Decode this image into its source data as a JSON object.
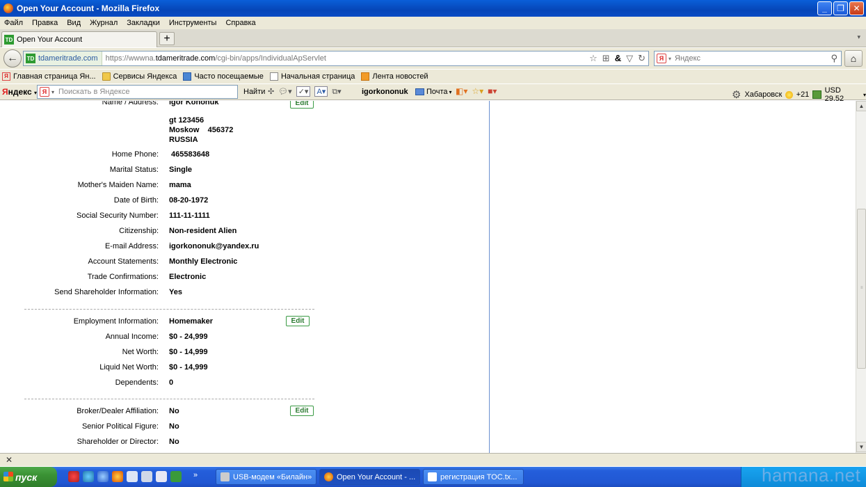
{
  "window": {
    "title": "Open Your Account - Mozilla Firefox"
  },
  "menu": [
    "Файл",
    "Правка",
    "Вид",
    "Журнал",
    "Закладки",
    "Инструменты",
    "Справка"
  ],
  "tab": {
    "label": "Open Your Account"
  },
  "nav": {
    "site": "tdameritrade.com",
    "url_prefix": "https://wwwna.",
    "url_domain": "tdameritrade.com",
    "url_path": "/cgi-bin/apps/IndividualApServlet",
    "search_placeholder": "Яндекс"
  },
  "bookmarks": [
    {
      "label": "Главная страница Ян...",
      "icon": "yandex-icon"
    },
    {
      "label": "Сервисы Яндекса",
      "icon": "folder-icon"
    },
    {
      "label": "Часто посещаемые",
      "icon": "bookmark-icon"
    },
    {
      "label": "Начальная страница",
      "icon": "page-icon"
    },
    {
      "label": "Лента новостей",
      "icon": "rss-icon"
    }
  ],
  "yandex_bar": {
    "logo_first": "Я",
    "logo_rest": "ндекс",
    "search_placeholder": "Поискать в Яндексе",
    "find_label": "Найти",
    "user": "igorkononuk",
    "mail": "Почта",
    "city": "Хабаровск",
    "temp": "+21",
    "currency": "USD 29,52"
  },
  "form": {
    "edit_label": "Edit",
    "personal": [
      {
        "label": "Name / Address:",
        "value": "igor  Kononuk"
      },
      {
        "label": "",
        "value": "gt 123456"
      },
      {
        "label": "",
        "value": "Moskow    456372"
      },
      {
        "label": "",
        "value": "RUSSIA"
      },
      {
        "label": "Home Phone:",
        "value": "465583648"
      },
      {
        "label": "Marital Status:",
        "value": "Single"
      },
      {
        "label": "Mother's Maiden Name:",
        "value": "mama"
      },
      {
        "label": "Date of Birth:",
        "value": "08-20-1972"
      },
      {
        "label": "Social Security Number:",
        "value": "111-11-1111"
      },
      {
        "label": "Citizenship:",
        "value": "Non-resident Alien"
      },
      {
        "label": "E-mail Address:",
        "value": "igorkononuk@yandex.ru"
      },
      {
        "label": "Account Statements:",
        "value": "Monthly Electronic"
      },
      {
        "label": "Trade Confirmations:",
        "value": "Electronic"
      },
      {
        "label": "Send Shareholder Information:",
        "value": "Yes"
      }
    ],
    "employment": [
      {
        "label": "Employment Information:",
        "value": "Homemaker"
      },
      {
        "label": "Annual Income:",
        "value": "$0 - 24,999"
      },
      {
        "label": "Net Worth:",
        "value": "$0 - 14,999"
      },
      {
        "label": "Liquid Net Worth:",
        "value": "$0 - 14,999"
      },
      {
        "label": "Dependents:",
        "value": "0"
      }
    ],
    "affiliation": [
      {
        "label": "Broker/Dealer Affiliation:",
        "value": "No"
      },
      {
        "label": "Senior Political Figure:",
        "value": "No"
      },
      {
        "label": "Shareholder or Director:",
        "value": "No"
      }
    ]
  },
  "taskbar": {
    "start_label": "пуск",
    "tasks": [
      "USB-модем «Билайн»",
      "Open Your Account - ...",
      "регистрация TOC.tx..."
    ],
    "watermark": "hamana.net"
  }
}
